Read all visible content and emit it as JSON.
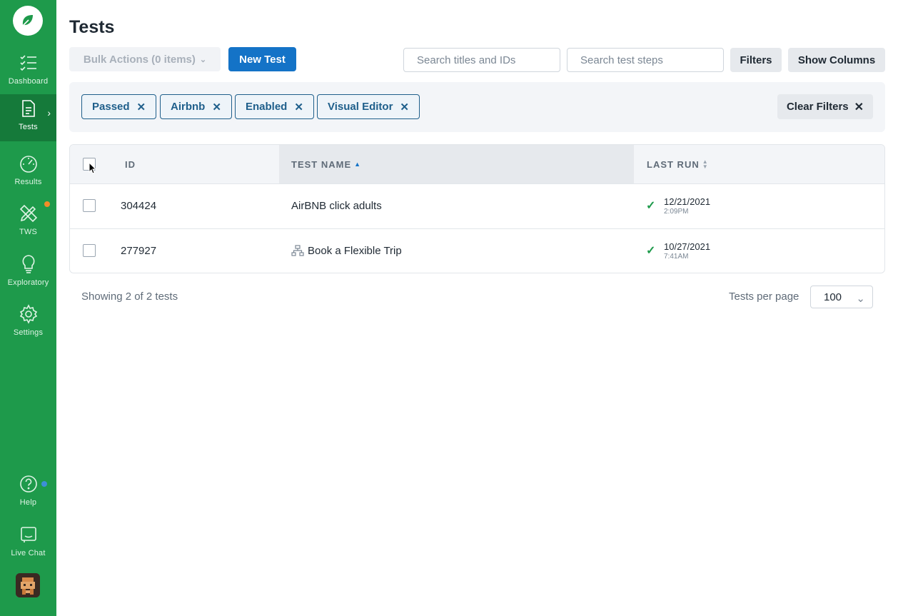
{
  "sidebar": {
    "logo_icon": "leaf-icon",
    "items": [
      {
        "label": "Dashboard",
        "icon": "checklist-icon"
      },
      {
        "label": "Tests",
        "icon": "document-icon",
        "active": true
      },
      {
        "label": "Results",
        "icon": "gauge-icon"
      },
      {
        "label": "TWS",
        "icon": "pencil-ruler-icon",
        "badge_color": "#f28c28"
      },
      {
        "label": "Exploratory",
        "icon": "lightbulb-icon"
      },
      {
        "label": "Settings",
        "icon": "gear-icon"
      }
    ],
    "bottom": [
      {
        "label": "Help",
        "icon": "question-icon",
        "badge_color": "#3d8fd6"
      },
      {
        "label": "Live Chat",
        "icon": "chat-icon"
      }
    ]
  },
  "page": {
    "title": "Tests"
  },
  "toolbar": {
    "bulk_label": "Bulk Actions (0 items)",
    "new_test_label": "New Test",
    "search_titles_placeholder": "Search titles and IDs",
    "search_steps_placeholder": "Search test steps",
    "filters_label": "Filters",
    "show_columns_label": "Show Columns"
  },
  "filters": {
    "chips": [
      "Passed",
      "Airbnb",
      "Enabled",
      "Visual Editor"
    ],
    "clear_label": "Clear Filters"
  },
  "table": {
    "headers": {
      "id": "ID",
      "name": "TEST NAME",
      "last_run": "LAST RUN"
    },
    "rows": [
      {
        "id": "304424",
        "name": "AirBNB click adults",
        "date": "12/21/2021",
        "time": "2:09PM",
        "status": "passed"
      },
      {
        "id": "277927",
        "name": "Book a Flexible Trip",
        "date": "10/27/2021",
        "time": "7:41AM",
        "status": "passed",
        "icon": "sitemap-icon"
      }
    ]
  },
  "footer": {
    "showing": "Showing 2 of 2 tests",
    "per_page_label": "Tests per page",
    "per_page_value": "100"
  },
  "colors": {
    "sidebar": "#1e9a4b",
    "primary": "#1473c7",
    "chip": "#1f5f8b",
    "success": "#1e9a4b"
  }
}
